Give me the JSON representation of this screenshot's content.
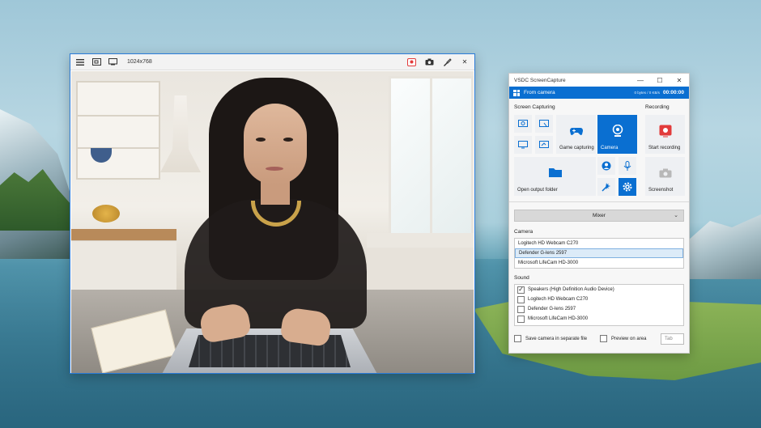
{
  "preview": {
    "resolution": "1024x768",
    "toolbar_icons": [
      "menu-icon",
      "region-select-icon",
      "monitor-icon",
      "record-cam-icon",
      "camera-icon",
      "brush-icon",
      "close-icon"
    ],
    "close_glyph": "✕"
  },
  "capture": {
    "title": "VSDC ScreenCapture",
    "window_controls": {
      "minimize": "—",
      "maximize": "☐",
      "close": "✕"
    },
    "source_label": "From camera",
    "bytes_info": "0 bytes / 0 KB/s",
    "timer": "00:00:00",
    "screen_capturing_label": "Screen Capturing",
    "recording_label": "Recording",
    "tiles": {
      "game_capturing": "Game capturing",
      "camera": "Camera",
      "open_output_folder": "Open output folder",
      "start_recording": "Start recording",
      "screenshot": "Screenshot"
    },
    "mixer_label": "Mixer",
    "camera_section_label": "Camera",
    "camera_devices": [
      "Logitech HD Webcam C270",
      "Defender G-lens 2597",
      "Microsoft LifeCam HD-3000"
    ],
    "selected_camera": 1,
    "sound_section_label": "Sound",
    "sound_devices": [
      {
        "label": "Speakers (High Definition Audio Device)",
        "checked": true
      },
      {
        "label": "Logitech HD Webcam C270",
        "checked": false
      },
      {
        "label": "Defender G-lens 2597",
        "checked": false
      },
      {
        "label": "Microsoft LifeCam HD-3000",
        "checked": false
      }
    ],
    "save_camera_label": "Save camera in separate file",
    "preview_on_area_label": "Preview on area",
    "tab_placeholder": "Tab",
    "check_glyph": "✓",
    "chevron_glyph": "⌄"
  },
  "colors": {
    "accent": "#0a6fd1",
    "record_red": "#e23b3b",
    "preview_border": "#2b7bd8"
  }
}
